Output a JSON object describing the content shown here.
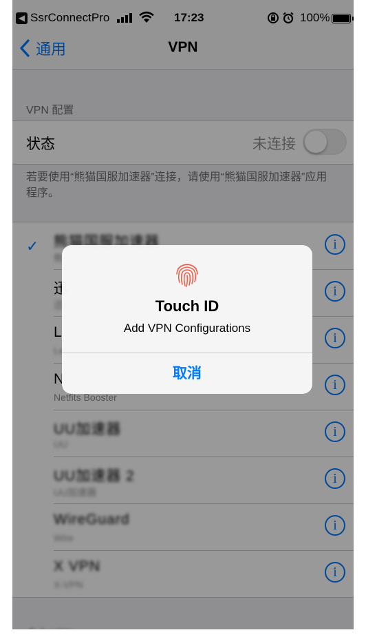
{
  "status_bar": {
    "back_app_glyph": "◀",
    "back_app": "SsrConnectPro",
    "time": "17:23",
    "battery": "100%",
    "icons": [
      "signal-bars-icon",
      "wifi-icon",
      "rotation-lock-icon",
      "alarm-icon",
      "battery-icon"
    ]
  },
  "nav": {
    "back_label": "通用",
    "title": "VPN"
  },
  "vpn_config": {
    "section_header": "VPN 配置",
    "status_label": "状态",
    "status_value": "未连接",
    "toggle_on": false,
    "footer_note": "若要使用“熊猫国服加速器”连接，请使用“熊猫国服加速器”应用程序。"
  },
  "vpn_list": [
    {
      "name": "熊猫国服加速器",
      "subtitle": "熊",
      "selected": true,
      "check": "✓"
    },
    {
      "name": "迅",
      "subtitle": "迅"
    },
    {
      "name": "L",
      "subtitle": "Le"
    },
    {
      "name": "N",
      "subtitle": "Netfits Booster"
    },
    {
      "name": "UU加速器",
      "subtitle": "UU"
    },
    {
      "name": "UU加速器 2",
      "subtitle": "UU加速器"
    },
    {
      "name": "WireGuard",
      "subtitle": "Wire"
    },
    {
      "name": "X VPN",
      "subtitle": "X-VPN"
    }
  ],
  "bottom_section_header": "个人 VPN",
  "alert": {
    "icon": "fingerprint-icon",
    "title": "Touch ID",
    "message": "Add VPN Configurations",
    "cancel_label": "取消"
  },
  "colors": {
    "accent": "#007aff",
    "background": "#efeff4",
    "fingerprint": "#f0604c"
  },
  "info_glyph": "i"
}
